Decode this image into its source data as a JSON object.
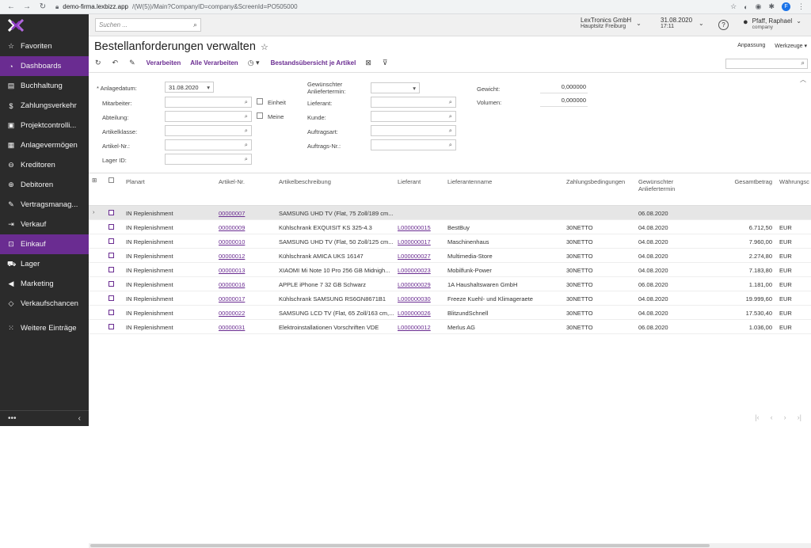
{
  "browser": {
    "url_host": "demo-firma.lexbizz.app",
    "url_path": "/(W(5))/Main?CompanyID=company&ScreenId=PO505000"
  },
  "appbar": {
    "search_placeholder": "Suchen ...",
    "company_name": "LexTronics GmbH",
    "company_branch": "Hauptsitz Freiburg",
    "date": "31.08.2020",
    "time": "17:11",
    "user_name": "Pfaff, Raphael",
    "user_company": "company",
    "profile_letter": "F"
  },
  "sidebar": {
    "items": [
      {
        "label": "Favoriten",
        "icon": "star-icon"
      },
      {
        "label": "Dashboards",
        "icon": "dashboard-icon"
      },
      {
        "label": "Buchhaltung",
        "icon": "ledger-icon"
      },
      {
        "label": "Zahlungsverkehr",
        "icon": "dollar-icon"
      },
      {
        "label": "Projektcontrolli...",
        "icon": "project-icon"
      },
      {
        "label": "Anlagevermögen",
        "icon": "assets-icon"
      },
      {
        "label": "Kreditoren",
        "icon": "minus-circle-icon"
      },
      {
        "label": "Debitoren",
        "icon": "plus-circle-icon"
      },
      {
        "label": "Vertragsmanag...",
        "icon": "contract-icon"
      },
      {
        "label": "Verkauf",
        "icon": "sales-icon"
      },
      {
        "label": "Einkauf",
        "icon": "cart-icon"
      },
      {
        "label": "Lager",
        "icon": "truck-icon"
      },
      {
        "label": "Marketing",
        "icon": "megaphone-icon"
      },
      {
        "label": "Verkaufschancen",
        "icon": "tag-icon"
      }
    ],
    "more_label": "Weitere Einträge",
    "bottom_dots": "•••",
    "collapse": "‹"
  },
  "page": {
    "title": "Bestellanforderungen verwalten",
    "customize": "Anpassung",
    "tools": "Werkzeuge",
    "toolbar": {
      "process": "Verarbeiten",
      "process_all": "Alle Verarbeiten",
      "stock_overview": "Bestandsübersicht je Artikel"
    }
  },
  "filters": {
    "date_label": "* Anlagedatum:",
    "date_value": "31.08.2020",
    "employee_label": "Mitarbeiter:",
    "department_label": "Abteilung:",
    "item_class_label": "Artikelklasse:",
    "item_no_label": "Artikel-Nr.:",
    "warehouse_label": "Lager ID:",
    "unit_label": "Einheit",
    "mine_label": "Meine",
    "desired_date_label_1": "Gewünschter",
    "desired_date_label_2": "Anliefertermin:",
    "vendor_label": "Lieferant:",
    "customer_label": "Kunde:",
    "order_type_label": "Auftragsart:",
    "order_no_label": "Auftrags-Nr.:",
    "weight_label": "Gewicht:",
    "weight_value": "0,000000",
    "volume_label": "Volumen:",
    "volume_value": "0,000000"
  },
  "grid": {
    "headers": {
      "plan_type": "Planart",
      "item_no": "Artikel-Nr.",
      "description": "Artikelbeschreibung",
      "vendor": "Lieferant",
      "vendor_name": "Lieferantenname",
      "terms": "Zahlungsbedingungen",
      "desired_1": "Gewünschter",
      "desired_2": "Anliefertermin",
      "total": "Gesamtbetrag",
      "currency": "Währungsc"
    },
    "rows": [
      {
        "plan": "IN Replenishment",
        "item": "00000007",
        "desc": "SAMSUNG UHD TV (Flat, 75 Zoll/189 cm...",
        "vendor": "",
        "vendor_name": "",
        "terms": "",
        "date": "06.08.2020",
        "total": "",
        "cur": ""
      },
      {
        "plan": "IN Replenishment",
        "item": "00000009",
        "desc": "Kühlschrank EXQUISIT KS 325-4.3",
        "vendor": "L000000015",
        "vendor_name": "BestBuy",
        "terms": "30NETTO",
        "date": "04.08.2020",
        "total": "6.712,50",
        "cur": "EUR"
      },
      {
        "plan": "IN Replenishment",
        "item": "00000010",
        "desc": "SAMSUNG UHD TV (Flat, 50 Zoll/125 cm...",
        "vendor": "L000000017",
        "vendor_name": "Maschinenhaus",
        "terms": "30NETTO",
        "date": "04.08.2020",
        "total": "7.960,00",
        "cur": "EUR"
      },
      {
        "plan": "IN Replenishment",
        "item": "00000012",
        "desc": "Kühlschrank AMICA UKS 16147",
        "vendor": "L000000027",
        "vendor_name": "Multimedia-Store",
        "terms": "30NETTO",
        "date": "04.08.2020",
        "total": "2.274,80",
        "cur": "EUR"
      },
      {
        "plan": "IN Replenishment",
        "item": "00000013",
        "desc": "XIAOMI Mi Note 10 Pro 256 GB Midnigh...",
        "vendor": "L000000023",
        "vendor_name": "Mobilfunk-Power",
        "terms": "30NETTO",
        "date": "04.08.2020",
        "total": "7.183,80",
        "cur": "EUR"
      },
      {
        "plan": "IN Replenishment",
        "item": "00000016",
        "desc": "APPLE iPhone 7 32 GB Schwarz",
        "vendor": "L000000029",
        "vendor_name": "1A Haushaltswaren GmbH",
        "terms": "30NETTO",
        "date": "06.08.2020",
        "total": "1.181,00",
        "cur": "EUR"
      },
      {
        "plan": "IN Replenishment",
        "item": "00000017",
        "desc": "Kühlschrank SAMSUNG RS6GN8671B1",
        "vendor": "L000000030",
        "vendor_name": "Freeze Kuehl- und Klimageraete",
        "terms": "30NETTO",
        "date": "04.08.2020",
        "total": "19.999,60",
        "cur": "EUR"
      },
      {
        "plan": "IN Replenishment",
        "item": "00000022",
        "desc": "SAMSUNG LCD TV (Flat, 65 Zoll/163 cm,...",
        "vendor": "L000000026",
        "vendor_name": "BlitzundSchnell",
        "terms": "30NETTO",
        "date": "04.08.2020",
        "total": "17.530,40",
        "cur": "EUR"
      },
      {
        "plan": "IN Replenishment",
        "item": "00000031",
        "desc": "Elektroinstallationen Vorschriften VDE",
        "vendor": "L000000012",
        "vendor_name": "Merlus AG",
        "terms": "30NETTO",
        "date": "06.08.2020",
        "total": "1.036,00",
        "cur": "EUR"
      }
    ]
  },
  "colors": {
    "accent": "#6a2c91",
    "sidebar_bg": "#2b2b2b"
  }
}
